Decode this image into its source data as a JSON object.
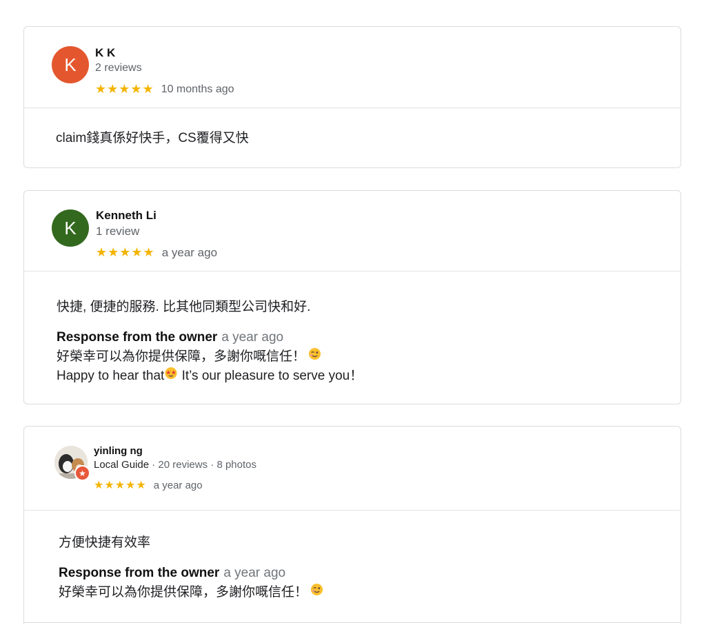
{
  "reviews": [
    {
      "avatar_letter": "K",
      "avatar_color": "#e4572e",
      "name": "K K",
      "meta": "2 reviews",
      "stars": "★★★★★",
      "time": "10 months ago",
      "text": "claim錢真係好快手，CS覆得又快"
    },
    {
      "avatar_letter": "K",
      "avatar_color": "#33691e",
      "name": "Kenneth Li",
      "meta": "1 review",
      "stars": "★★★★★",
      "time": "a year ago",
      "text": "快捷, 便捷的服務. 比其他同類型公司快和好.",
      "response_title": "Response from the owner",
      "response_time": "a year ago",
      "response_line1": "好榮幸可以為你提供保障，多謝你嘅信任！",
      "response_line2a": "Happy to hear that",
      "response_line2b": " It’s our pleasure to serve you！"
    },
    {
      "name": "yinling ng",
      "meta_guide": "Local Guide",
      "meta_reviews": "20 reviews",
      "meta_photos": "8 photos",
      "meta_sep": "·",
      "stars": "★★★★★",
      "time": "a year ago",
      "text": "方便快捷有效率",
      "response_title": "Response from the owner",
      "response_time": "a year ago",
      "response_line1": "好榮幸可以為你提供保障，多謝你嘅信任！"
    }
  ],
  "icons": {
    "wink": "wink-emoji",
    "starstruck": "star-struck-emoji",
    "local_guide_badge": "local-guide-badge-icon"
  },
  "colors": {
    "star": "#f4b400",
    "badge": "#e8573a"
  }
}
